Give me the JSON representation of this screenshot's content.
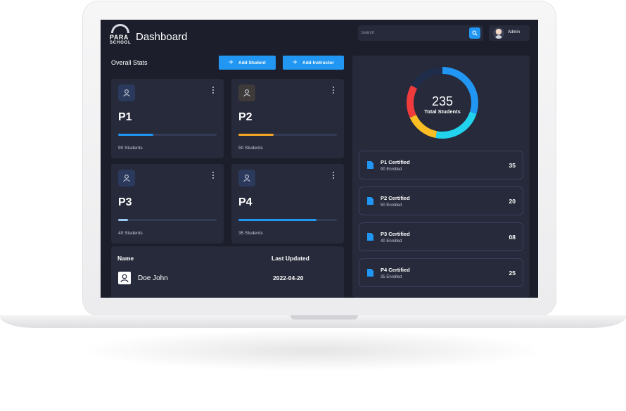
{
  "brand": {
    "line1": "PARA",
    "line2": "SCHOOL"
  },
  "header": {
    "title": "Dashboard",
    "search_placeholder": "Search",
    "user_name": "Admin"
  },
  "toolbar": {
    "section_title": "Overall Stats",
    "add_student_label": "Add Student",
    "add_instructor_label": "Add Instructor"
  },
  "cards": [
    {
      "name": "P1",
      "count_text": "90 Students",
      "progress": 0.36,
      "color": "#2196f3",
      "icon_bg": "#2b3a5c"
    },
    {
      "name": "P2",
      "count_text": "50 Students",
      "progress": 0.36,
      "color": "#f5a623",
      "icon_bg": "#3f3a3a"
    },
    {
      "name": "P3",
      "count_text": "40 Students",
      "progress": 0.1,
      "color": "#9cc8f5",
      "icon_bg": "#2b3a5c"
    },
    {
      "name": "P4",
      "count_text": "35 Students",
      "progress": 0.79,
      "color": "#2196f3",
      "icon_bg": "#2b3a5c"
    }
  ],
  "table": {
    "columns": [
      "Name",
      "Last Updated"
    ],
    "rows": [
      {
        "name": "Doe John",
        "last_updated": "2022-04-20"
      }
    ]
  },
  "summary": {
    "total": "235",
    "total_label": "Total Students",
    "segments": [
      {
        "value": 0.3,
        "color": "#2196f3"
      },
      {
        "value": 0.23,
        "color": "#22d3ee"
      },
      {
        "value": 0.15,
        "color": "#fbbf24"
      },
      {
        "value": 0.15,
        "color": "#ef3b3b"
      },
      {
        "value": 0.17,
        "color": "#1f2d4a"
      }
    ]
  },
  "certifications": [
    {
      "title": "P1 Certified",
      "enrolled": "90 Enrolled",
      "value": "35"
    },
    {
      "title": "P2 Certified",
      "enrolled": "50 Enrolled",
      "value": "20"
    },
    {
      "title": "P3 Certified",
      "enrolled": "40 Enrolled",
      "value": "08"
    },
    {
      "title": "P4 Certified",
      "enrolled": "35 Enrolled",
      "value": "25"
    }
  ],
  "colors": {
    "accent": "#2196f3",
    "background": "#1c1f2b",
    "card": "#262a3a"
  }
}
